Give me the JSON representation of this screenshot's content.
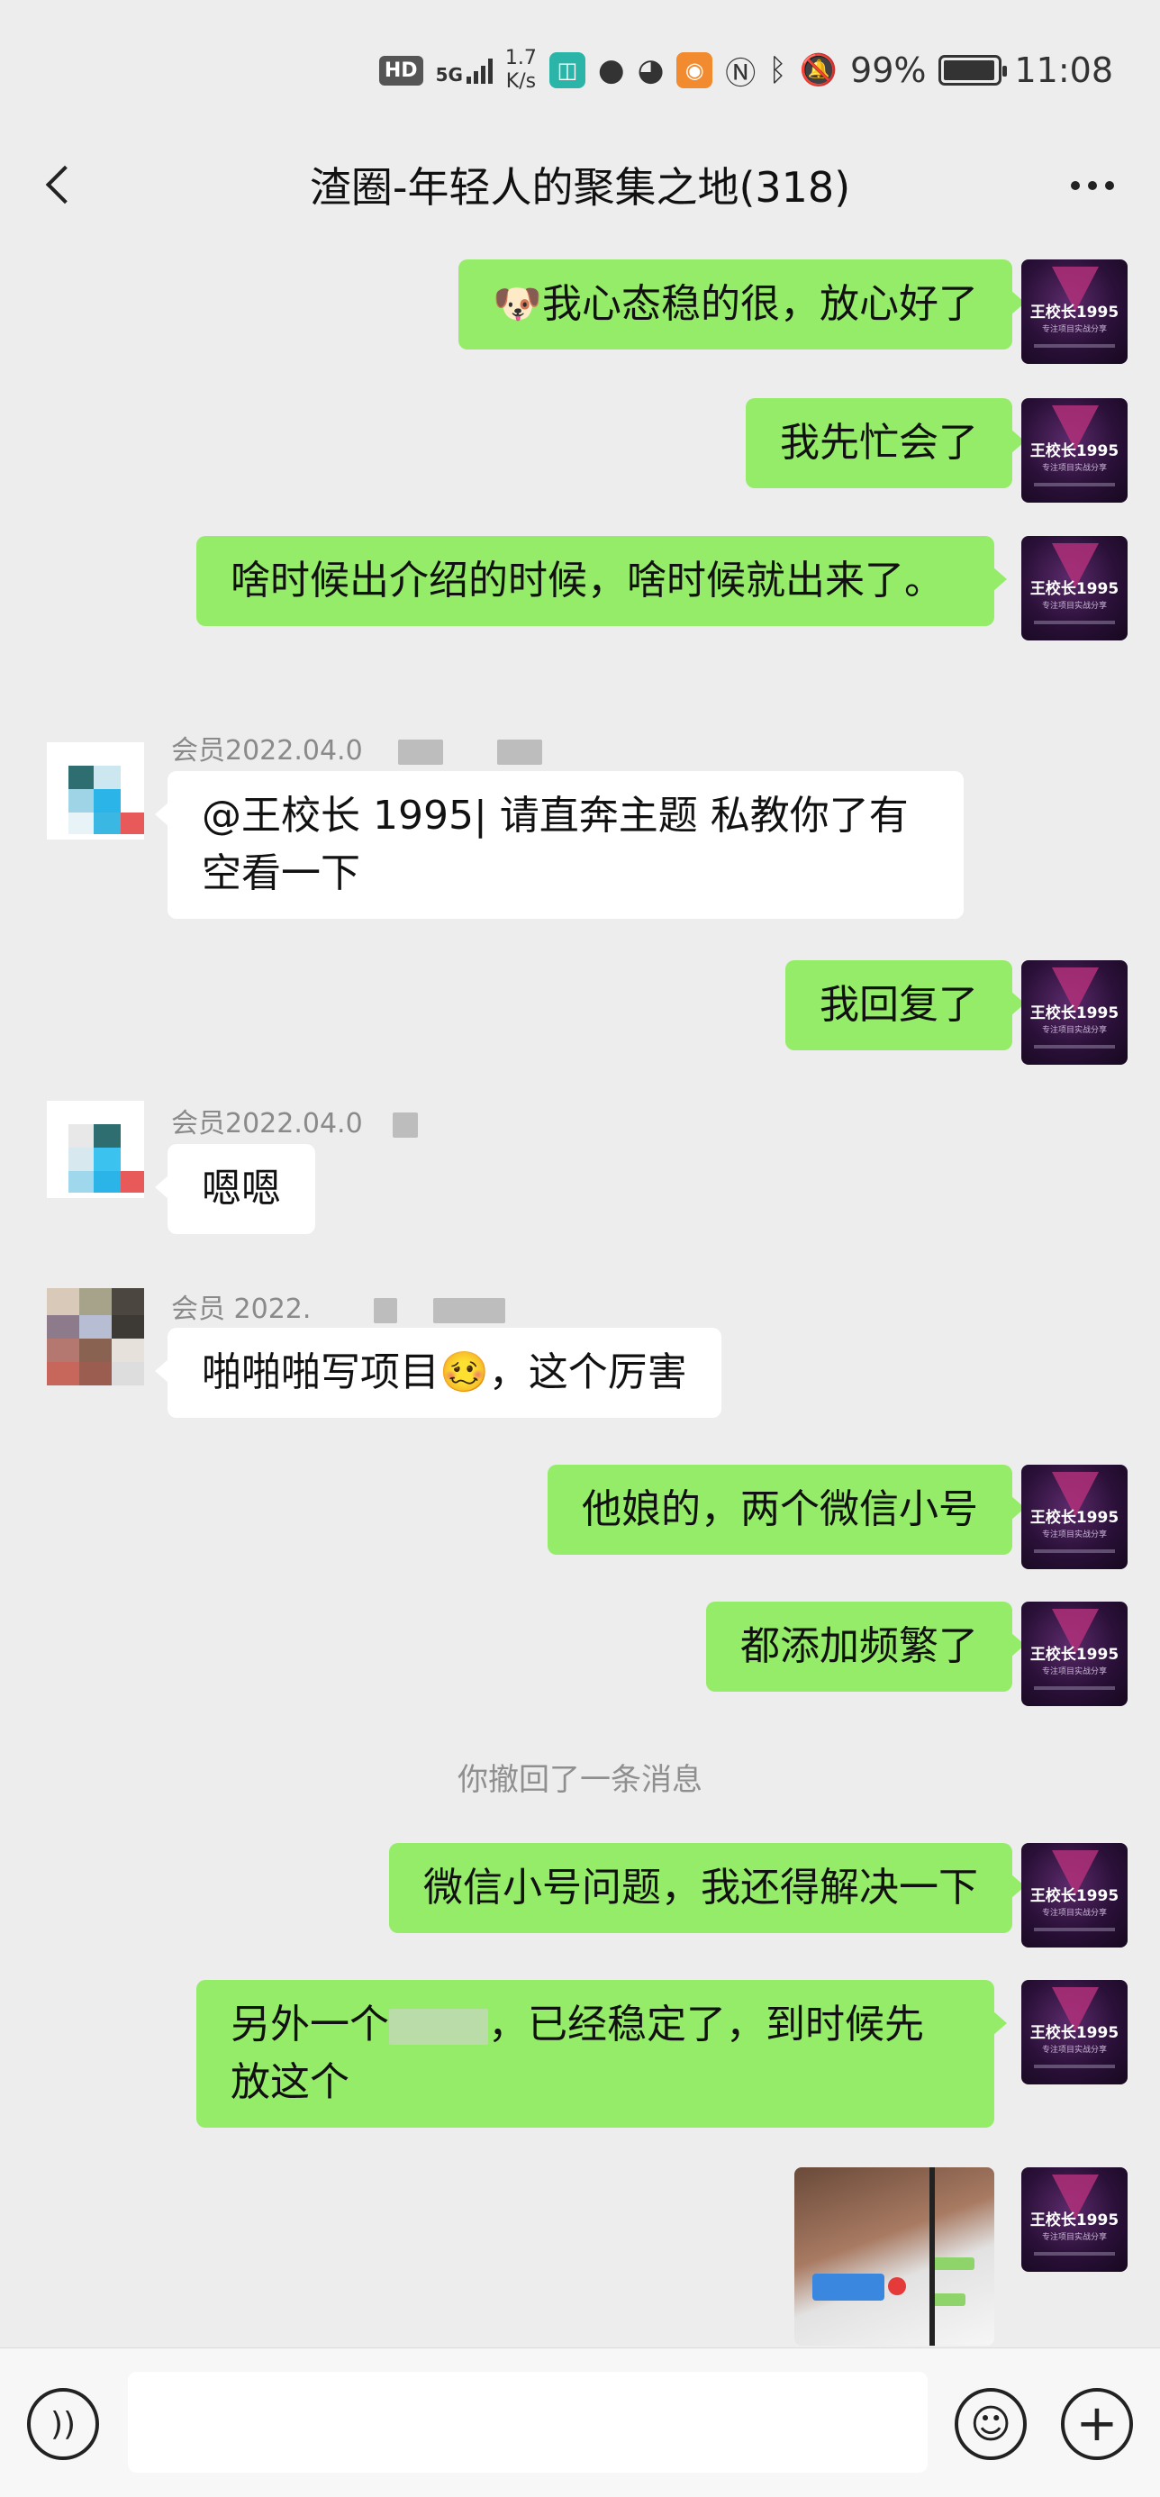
{
  "status_bar": {
    "hd": "HD",
    "network": "5G",
    "speed_value": "1.7",
    "speed_unit": "K/s",
    "battery": "99%",
    "time": "11:08",
    "icons": [
      "hd-icon",
      "signal-icon",
      "mi-app-icon",
      "chat-bubble-icon",
      "wechat-icon",
      "orange-app-icon",
      "nfc-icon",
      "bluetooth-icon",
      "mute-icon",
      "battery-icon"
    ]
  },
  "header": {
    "title": "渣圈-年轻人的聚集之地(318)",
    "back_icon": "chevron-left-icon",
    "more_icon": "more-dots-icon"
  },
  "me": {
    "avatar_name": "王校长1995",
    "avatar_subtitle": "专注项目实战分享"
  },
  "messages": [
    {
      "side": "out",
      "emoji": "🐶",
      "text": "我心态稳的很，放心好了"
    },
    {
      "side": "out",
      "text": "我先忙会了"
    },
    {
      "side": "out",
      "text": "啥时候出介绍的时候，啥时候就出来了。"
    },
    {
      "side": "in",
      "sender": "会员2022.04.0",
      "text": "@王校长 1995| 请直奔主题  私教你了有空看一下"
    },
    {
      "side": "out",
      "text": "我回复了"
    },
    {
      "side": "in",
      "sender": "会员2022.04.0",
      "text": "嗯嗯"
    },
    {
      "side": "in",
      "sender": "会员 2022.",
      "text_before": "啪啪啪写项目",
      "emoji": "🥴",
      "text_after": "，这个厉害"
    },
    {
      "side": "out",
      "text": "他娘的，两个微信小号"
    },
    {
      "side": "out",
      "text": "都添加频繁了"
    },
    {
      "side": "out",
      "text": "微信小号问题，我还得解决一下"
    },
    {
      "side": "out",
      "text_before": "另外一个",
      "text_after": "，已经稳定了，到时候先放这个"
    },
    {
      "side": "out",
      "type": "image"
    }
  ],
  "recall_notice": "你撤回了一条消息",
  "input_bar": {
    "voice_icon": "voice-icon",
    "placeholder": "",
    "emoji_icon": "emoji-icon",
    "plus_icon": "plus-icon"
  }
}
